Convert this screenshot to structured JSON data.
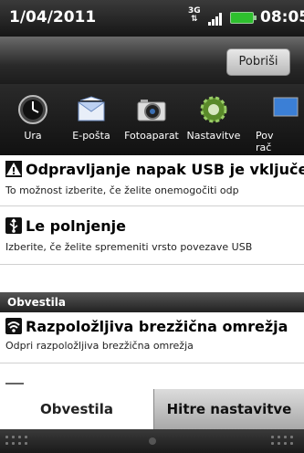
{
  "status_bar": {
    "date": "1/04/2011",
    "network": "3G",
    "time": "08:05"
  },
  "header": {
    "clear_button": "Pobriši"
  },
  "apps": [
    {
      "label": "Ura",
      "icon": "clock-icon"
    },
    {
      "label": "E-pošta",
      "icon": "mail-icon"
    },
    {
      "label": "Fotoaparat",
      "icon": "camera-icon"
    },
    {
      "label": "Nastavitve",
      "icon": "gear-icon"
    },
    {
      "label": "Pov\nrač",
      "icon": "computer-icon"
    }
  ],
  "notifications": [
    {
      "title": "Odpravljanje napak USB je vključe",
      "subtitle": "To možnost izberite, če želite onemogočiti odp",
      "icon": "warning-icon"
    },
    {
      "title": "Le polnjenje",
      "subtitle": "Izberite, če želite spremeniti vrsto povezave USB",
      "icon": "usb-icon"
    }
  ],
  "section_label": "Obvestila",
  "wifi_notification": {
    "title": "Razpoložljiva brezžična omrežja",
    "subtitle": "Odpri razpoložljiva brezžična omrežja",
    "icon": "wifi-icon"
  },
  "tabs": {
    "notifications": "Obvestila",
    "quick_settings": "Hitre nastavitve"
  },
  "colors": {
    "battery": "#2ec02e",
    "section_bg": "#333333"
  }
}
